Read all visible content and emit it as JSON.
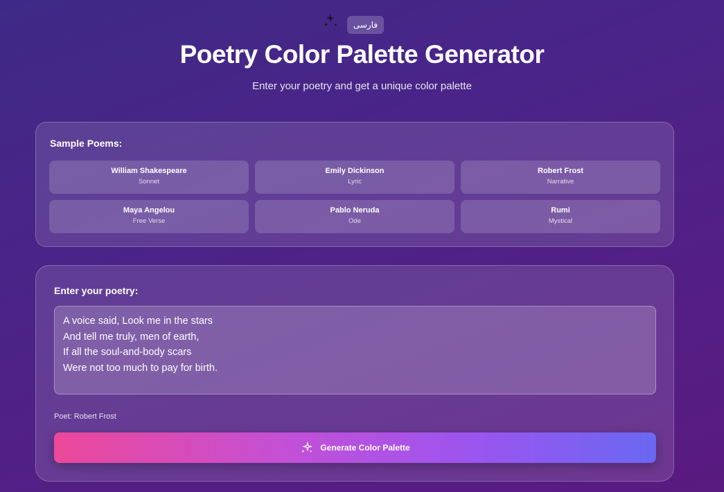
{
  "header": {
    "language_button": "فارسی",
    "title": "Poetry Color Palette Generator",
    "subtitle": "Enter your poetry and get a unique color palette",
    "icon": "sparkles-icon"
  },
  "samples": {
    "heading": "Sample Poems:",
    "items": [
      {
        "poet": "William Shakespeare",
        "type": "Sonnet"
      },
      {
        "poet": "Emily Dickinson",
        "type": "Lyric"
      },
      {
        "poet": "Robert Frost",
        "type": "Narrative"
      },
      {
        "poet": "Maya Angelou",
        "type": "Free Verse"
      },
      {
        "poet": "Pablo Neruda",
        "type": "Ode"
      },
      {
        "poet": "Rumi",
        "type": "Mystical"
      }
    ]
  },
  "input": {
    "label": "Enter your poetry:",
    "value": "A voice said, Look me in the stars\nAnd tell me truly, men of earth,\nIf all the soul-and-body scars\nWere not too much to pay for birth.",
    "poet_label": "Poet:",
    "poet_name": "Robert Frost",
    "generate_button": "Generate Color Palette",
    "button_icon": "sparkles-icon"
  },
  "colors": {
    "background": "#4a2488",
    "button_gradient_start": "#ec4899",
    "button_gradient_end": "#6a68f2"
  }
}
